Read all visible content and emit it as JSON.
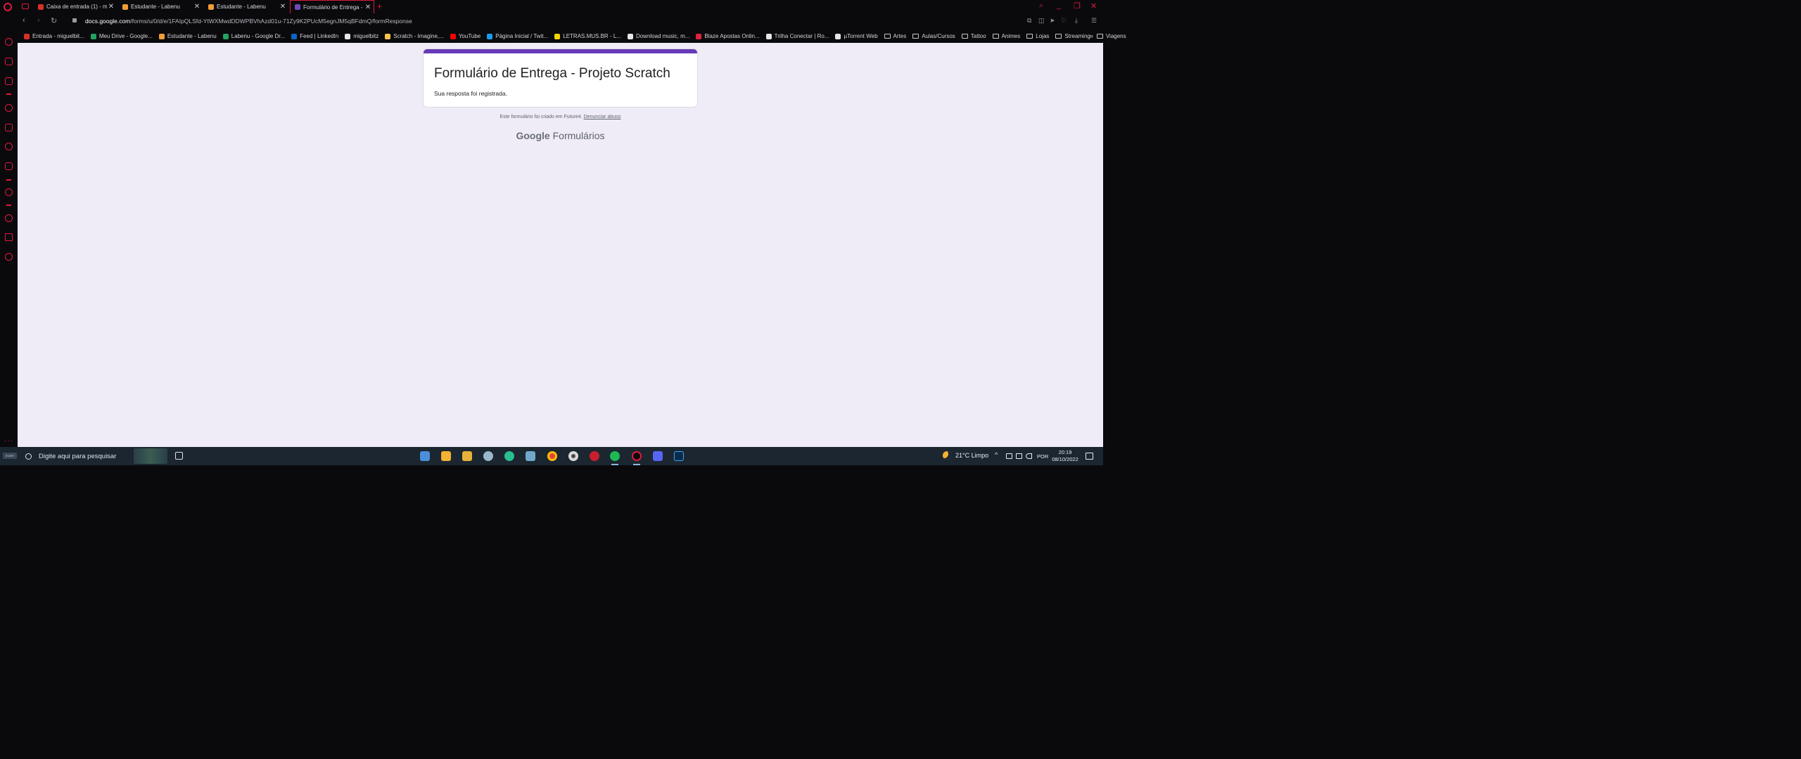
{
  "browser": {
    "tabs": [
      {
        "label": "Caixa de entrada (1) - mig…",
        "icon": "gmail-icon",
        "color": "#d93025"
      },
      {
        "label": "Estudante - Labenu",
        "icon": "labenu-icon",
        "color": "#f29d38"
      },
      {
        "label": "Estudante - Labenu",
        "icon": "labenu-icon",
        "color": "#f29d38"
      },
      {
        "label": "Formulário de Entrega - Pr…",
        "icon": "forms-icon",
        "color": "#7248b9",
        "active": true
      }
    ],
    "new_tab_glyph": "+",
    "address": {
      "host": "docs.google.com",
      "path": "/forms/u/0/d/e/1FAIpQLSfd-YtWXMwdDDWPBVhAzd01u-71Zy9K2PUcM5egnJM5qBFdmQ/formResponse"
    },
    "bookmarks": [
      {
        "label": "Entrada - miguelbit...",
        "icon": "gmail-icon",
        "color": "#d93025"
      },
      {
        "label": "Meu Drive - Google...",
        "icon": "drive-icon",
        "color": "#1fa463"
      },
      {
        "label": "Estudante - Labenu",
        "icon": "labenu-icon",
        "color": "#f29d38"
      },
      {
        "label": "Labenu - Google Dr...",
        "icon": "drive-icon",
        "color": "#1fa463"
      },
      {
        "label": "Feed | LinkedIn",
        "icon": "linkedin-icon",
        "color": "#0a66c2"
      },
      {
        "label": "miguelbitz",
        "icon": "github-icon",
        "color": "#e6e6e6"
      },
      {
        "label": "Scratch - Imagine,...",
        "icon": "scratch-icon",
        "color": "#f7c34a"
      },
      {
        "label": "YouTube",
        "icon": "youtube-icon",
        "color": "#ff0000"
      },
      {
        "label": "Página Inicial / Twit...",
        "icon": "twitter-icon",
        "color": "#1d9bf0"
      },
      {
        "label": "LETRAS.MUS.BR - L...",
        "icon": "letras-icon",
        "color": "#f2d600"
      },
      {
        "label": "Download music, m...",
        "icon": "download-icon",
        "color": "#e6e6e6"
      },
      {
        "label": "Blaze Apostas Onlin...",
        "icon": "blaze-icon",
        "color": "#e0223a"
      },
      {
        "label": "Trilha Conectar | Ro...",
        "icon": "rocket-icon",
        "color": "#e6e6e6"
      },
      {
        "label": "µTorrent Web",
        "icon": "page-icon",
        "color": "#e6e6e6"
      },
      {
        "label": "Artes",
        "icon": "folder-icon",
        "color": "#c8c8cf"
      },
      {
        "label": "Aulas/Cursos",
        "icon": "folder-icon",
        "color": "#c8c8cf"
      },
      {
        "label": "Tattoo",
        "icon": "folder-icon",
        "color": "#c8c8cf"
      },
      {
        "label": "Animes",
        "icon": "folder-icon",
        "color": "#c8c8cf"
      },
      {
        "label": "Lojas",
        "icon": "folder-icon",
        "color": "#c8c8cf"
      },
      {
        "label": "Streaming",
        "icon": "folder-icon",
        "color": "#c8c8cf"
      },
      {
        "label": "Viagens",
        "icon": "folder-icon",
        "color": "#c8c8cf"
      }
    ],
    "accent_color": "#e01a3c"
  },
  "form": {
    "title": "Formulário de Entrega - Projeto Scratch",
    "confirmation": "Sua resposta foi registrada.",
    "footer_text": "Este formulário foi criado em Future4.",
    "abuse_link": "Denunciar abuso",
    "brand_google": "Google",
    "brand_product": "Formulários",
    "header_color": "#673ab7"
  },
  "taskbar": {
    "start_label": "START",
    "search_placeholder": "Digite aqui para pesquisar",
    "weather": "21°C  Limpo",
    "language": "POR",
    "time": "20:19",
    "date": "08/10/2022"
  }
}
